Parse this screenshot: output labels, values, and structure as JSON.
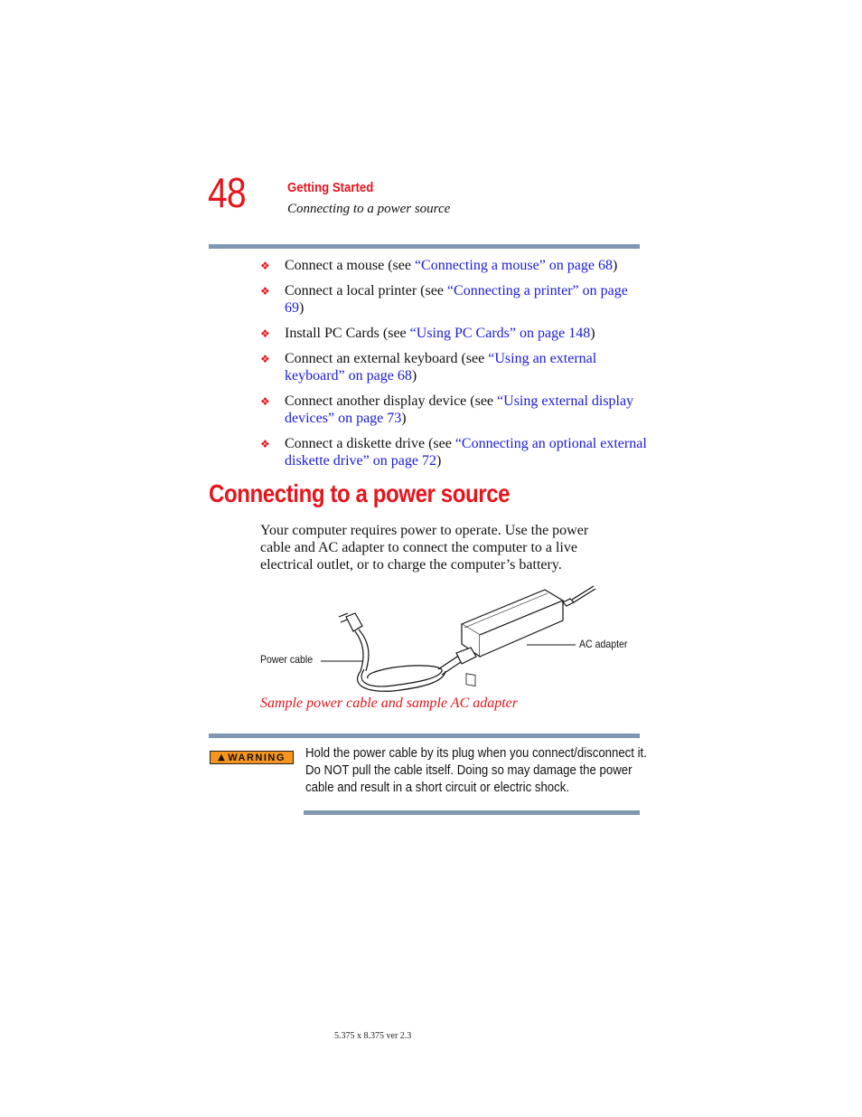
{
  "header": {
    "page_number": "48",
    "chapter": "Getting Started",
    "section": "Connecting to a power source"
  },
  "bullets": [
    {
      "pre": "Connect a mouse (see ",
      "link": "“Connecting a mouse” on page 68",
      "post": ")"
    },
    {
      "pre": "Connect a local printer (see ",
      "link": "“Connecting a printer” on page 69",
      "post": ")"
    },
    {
      "pre": "Install PC Cards (see ",
      "link": "“Using PC Cards” on page 148",
      "post": ")"
    },
    {
      "pre": "Connect an external keyboard (see ",
      "link": "“Using an external keyboard” on page 68",
      "post": ")"
    },
    {
      "pre": "Connect another display device (see ",
      "link": "“Using external display devices” on page 73",
      "post": ")"
    },
    {
      "pre": "Connect a diskette drive (see ",
      "link": "“Connecting an optional external diskette drive” on page 72",
      "post": ")"
    }
  ],
  "section_heading": "Connecting to a power source",
  "body_text": "Your computer requires power to operate. Use the power cable and AC adapter to connect the computer to a live electrical outlet, or to charge the computer’s battery.",
  "figure": {
    "label_power_cable": "Power cable",
    "label_ac_adapter": "AC adapter",
    "caption": "Sample power cable and sample AC adapter"
  },
  "warning": {
    "badge": "WARNING",
    "text": "Hold the power cable by its plug when you connect/disconnect it. Do NOT pull the cable itself. Doing so may damage the power cable and result in a short circuit or electric shock."
  },
  "footer": "5.375 x 8.375 ver 2.3",
  "colors": {
    "accent_red": "#e8141c",
    "link_blue": "#1a1adb",
    "rule_blue_gray": "#7f98b1",
    "warning_orange": "#f7941d"
  }
}
